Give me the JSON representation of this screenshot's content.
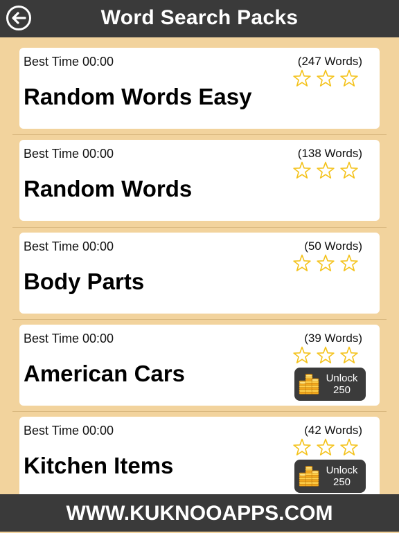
{
  "header": {
    "title": "Word Search Packs",
    "back_icon": "back-arrow-icon"
  },
  "packs": [
    {
      "best_time": "Best Time 00:00",
      "word_count": "(247 Words)",
      "title": "Random Words Easy",
      "stars": 0,
      "locked": false
    },
    {
      "best_time": "Best Time 00:00",
      "word_count": "(138 Words)",
      "title": "Random Words",
      "stars": 0,
      "locked": false
    },
    {
      "best_time": "Best Time 00:00",
      "word_count": "(50 Words)",
      "title": "Body Parts",
      "stars": 0,
      "locked": false
    },
    {
      "best_time": "Best Time 00:00",
      "word_count": "(39 Words)",
      "title": "American Cars",
      "stars": 0,
      "locked": true,
      "unlock_label": "Unlock",
      "unlock_cost": "250"
    },
    {
      "best_time": "Best Time 00:00",
      "word_count": "(42 Words)",
      "title": "Kitchen Items",
      "stars": 0,
      "locked": true,
      "unlock_label": "Unlock",
      "unlock_cost": "250"
    }
  ],
  "footer": {
    "text": "WWW.KUKNOOAPPS.COM"
  },
  "colors": {
    "background": "#f2d39d",
    "bar": "#3a3a3a",
    "star_outline": "#f4c21a",
    "coin": "#f3a91e"
  }
}
